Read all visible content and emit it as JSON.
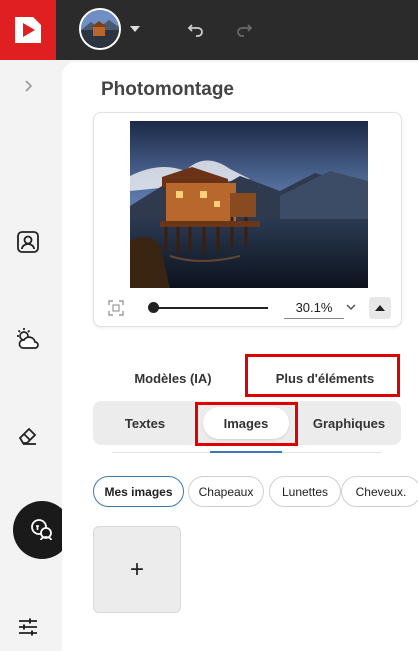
{
  "header": {
    "undo_label": "Undo",
    "redo_label": "Redo"
  },
  "sidebar": {
    "items": [
      {
        "icon": "chevron-right-icon"
      },
      {
        "icon": "portrait-icon"
      },
      {
        "icon": "weather-icon"
      },
      {
        "icon": "eraser-icon"
      },
      {
        "icon": "face-swap-icon"
      },
      {
        "icon": "sliders-icon"
      }
    ]
  },
  "panel": {
    "title": "Photomontage",
    "zoom": {
      "value": "30.1%"
    }
  },
  "main_tabs": [
    {
      "label": "Modèles (IA)"
    },
    {
      "label": "Plus d'éléments"
    }
  ],
  "sub_tabs": [
    {
      "label": "Textes"
    },
    {
      "label": "Images"
    },
    {
      "label": "Graphiques"
    }
  ],
  "chips": [
    {
      "label": "Mes images"
    },
    {
      "label": "Chapeaux"
    },
    {
      "label": "Lunettes"
    },
    {
      "label": "Cheveux."
    }
  ],
  "add_tile": {
    "label": "+"
  },
  "colors": {
    "brand": "#e02020",
    "highlight": "#e10000",
    "accent": "#3d78b5",
    "topbar": "#2b2b2b"
  }
}
